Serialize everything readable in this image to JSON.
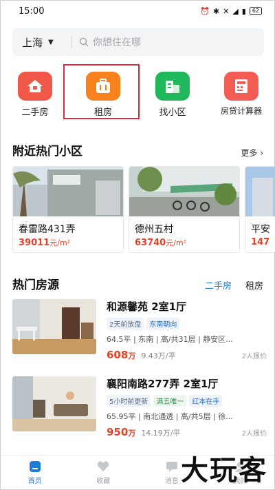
{
  "status_bar": {
    "time": "15:00",
    "battery": "62"
  },
  "search": {
    "city": "上海",
    "placeholder": "你想住在哪"
  },
  "quick_nav": [
    {
      "label": "二手房",
      "icon": "house-icon",
      "color": "#f0584a"
    },
    {
      "label": "租房",
      "icon": "suitcase-icon",
      "color": "#f6811d"
    },
    {
      "label": "找小区",
      "icon": "building-icon",
      "color": "#1fb85a"
    },
    {
      "label": "房贷计算器",
      "icon": "calculator-icon",
      "color": "#f35b55"
    }
  ],
  "nearby": {
    "title": "附近热门小区",
    "more": "更多",
    "cards": [
      {
        "name": "春雷路431弄",
        "price": "39011",
        "unit": "元/m²"
      },
      {
        "name": "德州五村",
        "price": "63740",
        "unit": "元/m²"
      },
      {
        "name": "平安",
        "price": "147"
      }
    ]
  },
  "hot": {
    "title": "热门房源",
    "tabs": [
      "二手房",
      "租房"
    ],
    "listings": [
      {
        "title": "和源馨苑 2室1厅",
        "tags": [
          "2天前放盘",
          "东南朝向"
        ],
        "meta": "64.5平 | 东南 | 高/共31层 | 静安区...",
        "price": "608",
        "price_unit": "万",
        "unit_price": "9.43万/平",
        "watchers": "2人报价"
      },
      {
        "title": "襄阳南路277弄 2室1厅",
        "tags": [
          "5小时前更新",
          "满五唯一",
          "红本在手"
        ],
        "meta": "65.95平 | 南北通透 | 高/共5层 | 徐...",
        "price": "950",
        "price_unit": "万",
        "unit_price": "14.19万/平",
        "watchers": "2人报价"
      }
    ]
  },
  "bottom_nav": [
    {
      "label": "首页",
      "icon": "home-icon"
    },
    {
      "label": "收藏",
      "icon": "heart-icon"
    },
    {
      "label": "消息",
      "icon": "message-icon"
    },
    {
      "label": "我的",
      "icon": "user-icon"
    }
  ],
  "watermark": "大玩客",
  "colors": {
    "accent": "#1f7bd8",
    "price": "#e3432b",
    "highlight": "#d72b3c"
  }
}
